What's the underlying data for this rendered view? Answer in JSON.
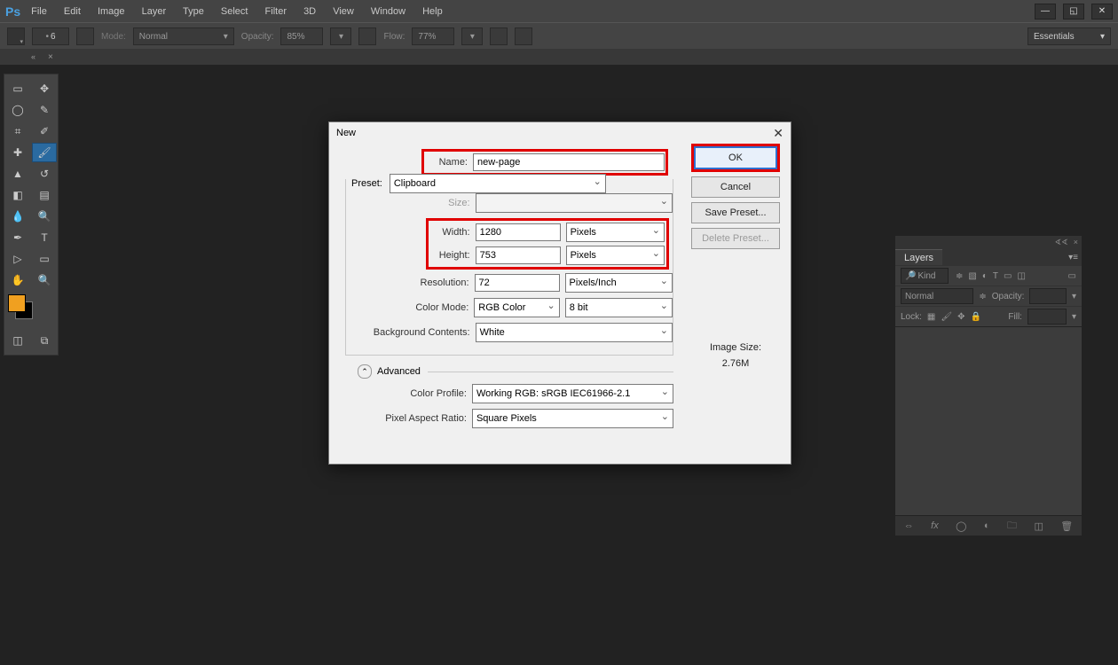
{
  "app": {
    "logo": "Ps"
  },
  "menu": {
    "file": "File",
    "edit": "Edit",
    "image": "Image",
    "layer": "Layer",
    "type": "Type",
    "select": "Select",
    "filter": "Filter",
    "threeD": "3D",
    "view": "View",
    "window": "Window",
    "help": "Help"
  },
  "options": {
    "brush_size": "6",
    "mode_label": "Mode:",
    "mode_value": "Normal",
    "opacity_label": "Opacity:",
    "opacity_value": "85%",
    "flow_label": "Flow:",
    "flow_value": "77%",
    "workspace": "Essentials"
  },
  "dialog": {
    "title": "New",
    "name_label": "Name:",
    "name_value": "new-page",
    "preset_label": "Preset:",
    "preset_value": "Clipboard",
    "size_label": "Size:",
    "size_value": "",
    "width_label": "Width:",
    "width_value": "1280",
    "width_unit": "Pixels",
    "height_label": "Height:",
    "height_value": "753",
    "height_unit": "Pixels",
    "res_label": "Resolution:",
    "res_value": "72",
    "res_unit": "Pixels/Inch",
    "cmode_label": "Color Mode:",
    "cmode_value": "RGB Color",
    "cmode_depth": "8 bit",
    "bg_label": "Background Contents:",
    "bg_value": "White",
    "advanced": "Advanced",
    "profile_label": "Color Profile:",
    "profile_value": "Working RGB:  sRGB IEC61966-2.1",
    "par_label": "Pixel Aspect Ratio:",
    "par_value": "Square Pixels",
    "ok": "OK",
    "cancel": "Cancel",
    "save_preset": "Save Preset...",
    "delete_preset": "Delete Preset...",
    "image_size_label": "Image Size:",
    "image_size_value": "2.76M"
  },
  "layers": {
    "tab": "Layers",
    "kind": "Kind",
    "blend": "Normal",
    "opacity_label": "Opacity:",
    "opacity_value": "",
    "lock_label": "Lock:",
    "fill_label": "Fill:"
  }
}
